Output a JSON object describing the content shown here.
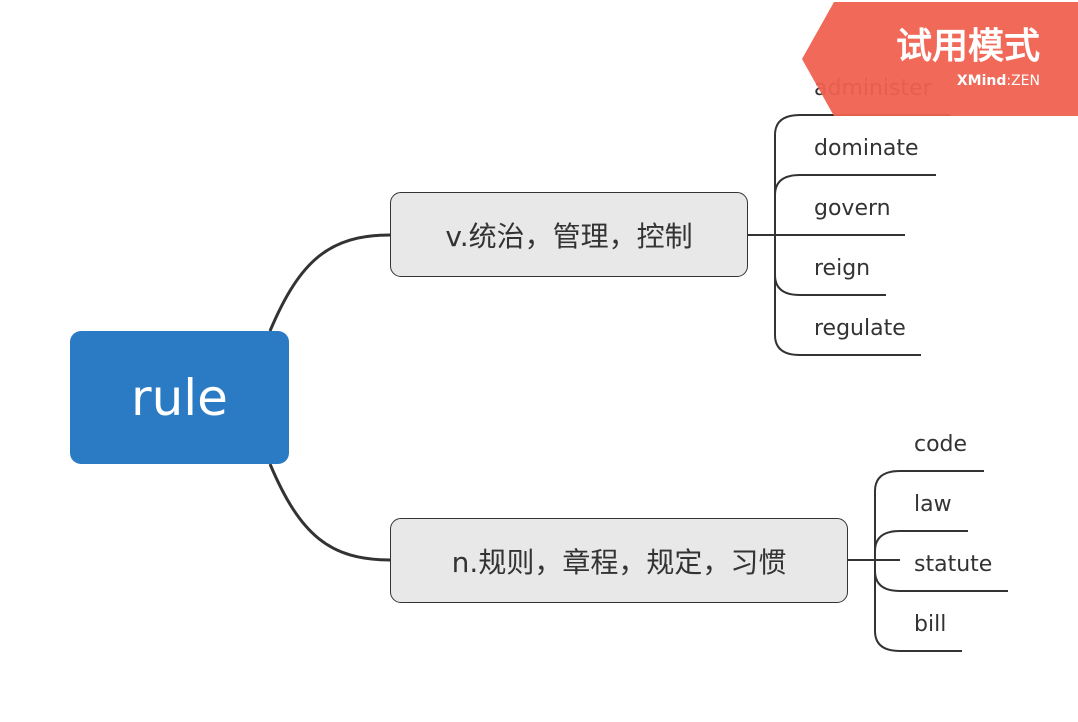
{
  "central_topic": "rule",
  "main_topics": [
    {
      "label": "v.统治，管理，控制",
      "subtopics": [
        "administer",
        "dominate",
        "govern",
        "reign",
        "regulate"
      ]
    },
    {
      "label": "n.规则，章程，规定，习惯",
      "subtopics": [
        "code",
        "law",
        "statute",
        "bill"
      ]
    }
  ],
  "watermark": {
    "title": "试用模式",
    "brand_bold": "XMind",
    "brand_sep": ":",
    "brand_light": "ZEN"
  },
  "colors": {
    "central_fill": "#2b7bc4",
    "main_fill": "#e8e8e8",
    "line": "#333333",
    "watermark": "#f0614f"
  }
}
